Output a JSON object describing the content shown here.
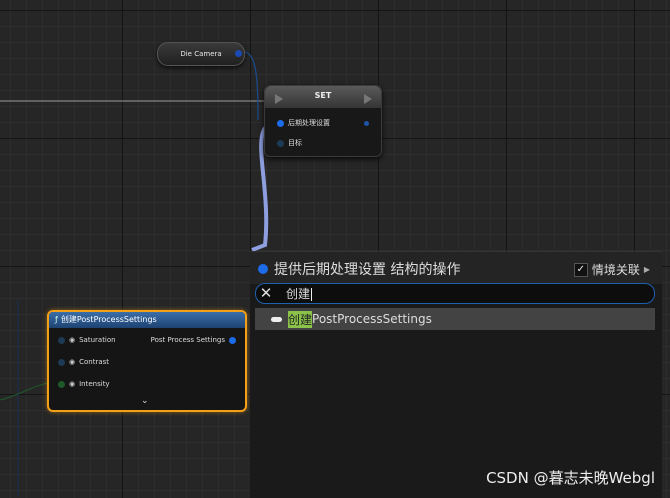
{
  "graph": {
    "getter_node": {
      "label": "Die Camera"
    },
    "set_node": {
      "title": "SET",
      "pins": [
        "后期处理设置",
        "目标"
      ]
    },
    "make_node": {
      "title": "创建PostProcessSettings",
      "inputs": [
        "Saturation",
        "Contrast",
        "Intensity"
      ],
      "output": "Post Process Settings",
      "expand_icon": "chevron-down-icon"
    }
  },
  "action_menu": {
    "title": "提供后期处理设置 结构的操作",
    "context_label": "情境关联",
    "context_checked": true,
    "search_value": "创建",
    "results": [
      {
        "highlight": "创建",
        "rest": "PostProcessSettings"
      }
    ]
  },
  "watermark": "CSDN @暮志未晚Webgl",
  "colors": {
    "selection_border": "#f3a019",
    "struct_pin": "#1c6be8",
    "wire": "#8e9fe0",
    "search_match": "#8bc34a"
  }
}
